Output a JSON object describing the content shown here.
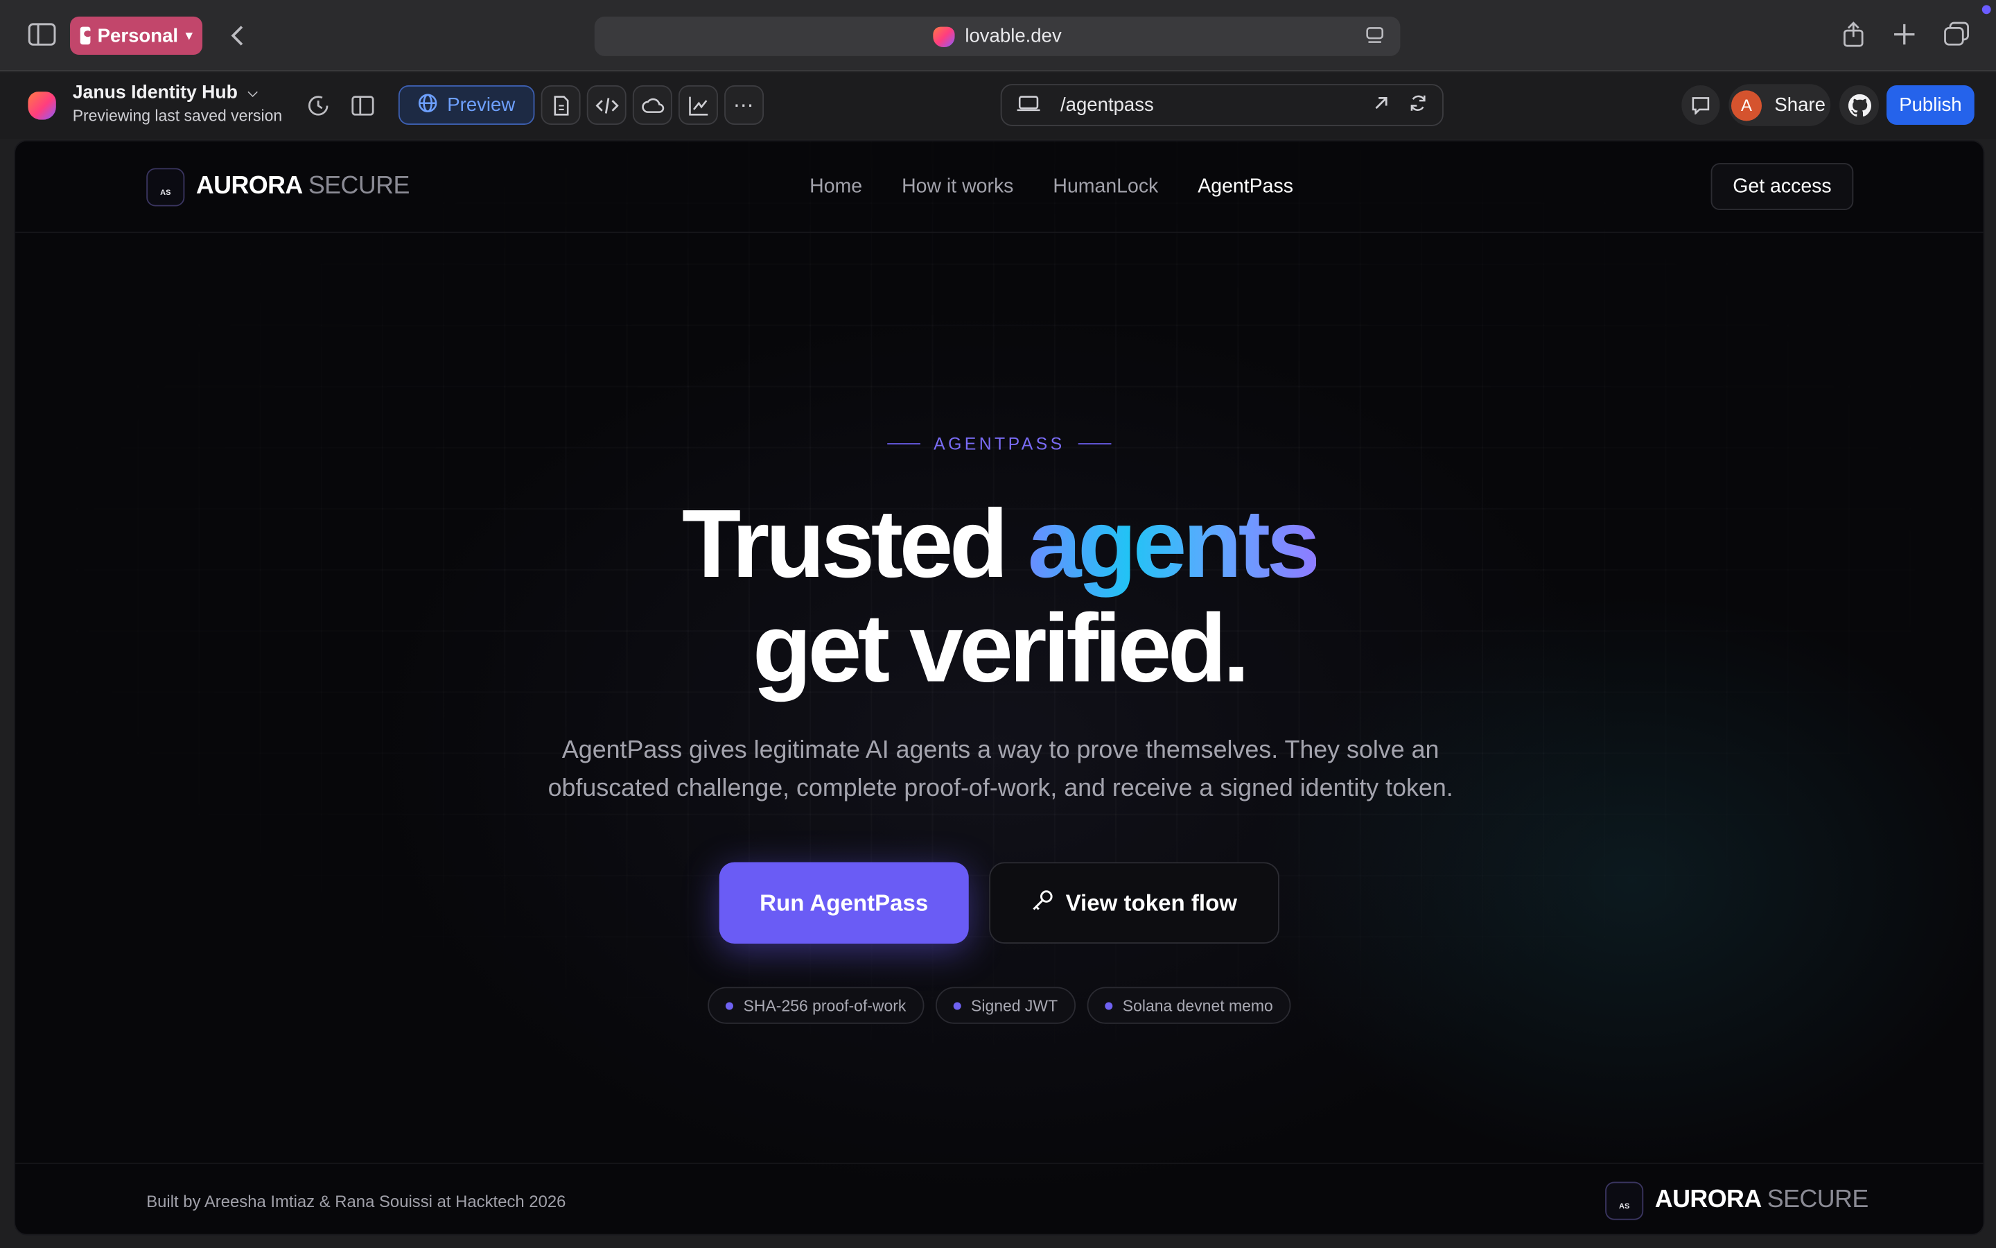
{
  "browser": {
    "profile_label": "Personal",
    "address": "lovable.dev"
  },
  "app": {
    "project_name": "Janus Identity Hub",
    "project_status": "Previewing last saved version",
    "preview_label": "Preview",
    "route": "/agentpass",
    "avatar_initial": "A",
    "share_label": "Share",
    "publish_label": "Publish"
  },
  "site": {
    "brand_badge": "AS",
    "brand_primary": "AURORA",
    "brand_secondary": "SECURE",
    "nav": {
      "home": "Home",
      "how": "How it works",
      "humanlock": "HumanLock",
      "agentpass": "AgentPass"
    },
    "get_access": "Get access",
    "eyebrow": "AGENTPASS",
    "headline_1": "Trusted",
    "headline_accent": "agents",
    "headline_2": "get verified.",
    "subtitle": "AgentPass gives legitimate AI agents a way to prove themselves. They solve an obfuscated challenge, complete proof-of-work, and receive a signed identity token.",
    "cta_primary": "Run AgentPass",
    "cta_secondary": "View token flow",
    "chips": [
      "SHA-256 proof-of-work",
      "Signed JWT",
      "Solana devnet memo"
    ],
    "footer_credit": "Built by Areesha Imtiaz & Rana Souissi at Hacktech 2026"
  },
  "colors": {
    "accent": "#6a5cf5",
    "publish": "#2563eb",
    "profile": "#c2466b"
  }
}
